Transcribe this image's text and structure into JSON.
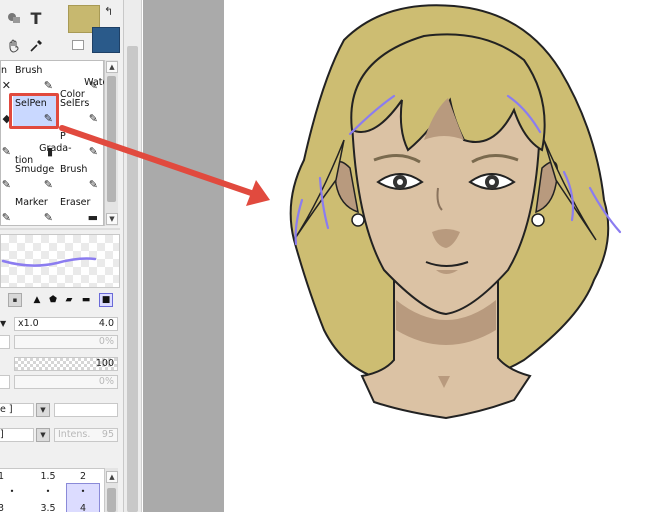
{
  "toolbar": {
    "text_tool_label": "T",
    "swap_glyph": "↰"
  },
  "colors": {
    "foreground": "#c7b86f",
    "background": "#2a5a8a",
    "highlight": "#e14a3e",
    "stroke_preview": "#8b7cf0"
  },
  "brush_tools": [
    {
      "label": "n",
      "glyph": "✕"
    },
    {
      "label": "Brush",
      "glyph": "✎"
    },
    {
      "label": "Water\nColor",
      "glyph": "✎"
    },
    {
      "label": "",
      "glyph": "◆"
    },
    {
      "label": "SelPen",
      "glyph": "✎"
    },
    {
      "label": "SelErs",
      "glyph": "✎"
    },
    {
      "label": "",
      "glyph": "✎"
    },
    {
      "label": "Grada-\ntion",
      "glyph": "▮"
    },
    {
      "label": "P",
      "glyph": "✎"
    },
    {
      "label": "",
      "glyph": "✎"
    },
    {
      "label": "Smudge",
      "glyph": "✎"
    },
    {
      "label": "Brush",
      "glyph": "✎"
    },
    {
      "label": "",
      "glyph": "✎"
    },
    {
      "label": "Marker",
      "glyph": "✎"
    },
    {
      "label": "Eraser",
      "glyph": "▬"
    }
  ],
  "brush_settings": {
    "size_multiplier": "x1.0",
    "size_value": "4.0",
    "min_size": "0%",
    "density": "100",
    "min_density": "0%",
    "blend_mode": "e ]",
    "texture": "]",
    "texture_intensity": "Intens.",
    "texture_intensity_value": "95"
  },
  "size_presets": {
    "row1": [
      "1",
      "1.5",
      "2"
    ],
    "row2": [
      "3",
      "3.5",
      "4"
    ],
    "selected": "2"
  }
}
